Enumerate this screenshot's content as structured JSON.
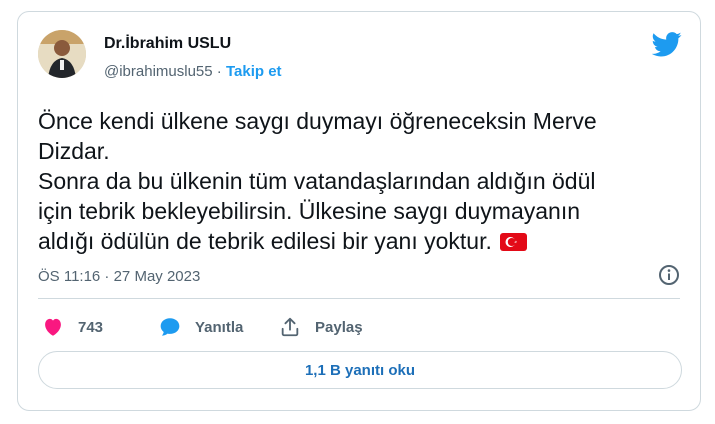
{
  "author": {
    "name": "Dr.İbrahim USLU",
    "handle": "@ibrahimuslu55",
    "separator": "·",
    "follow_label": "Takip et"
  },
  "tweet": {
    "line1": "Önce kendi ülkene saygı duymayı öğreneceksin Merve",
    "line2": "Dizdar.",
    "line3": "Sonra da bu ülkenin tüm vatandaşlarından aldığın ödül",
    "line4": "için tebrik bekleyebilirsin. Ülkesine saygı duymayanın",
    "line5": "aldığı ödülün de tebrik edilesi bir yanı yoktur.",
    "flag_emoji": "turkey-flag",
    "timestamp": "ÖS 11:16 · 27 May 2023"
  },
  "actions": {
    "like_count": "743",
    "reply_label": "Yanıtla",
    "share_label": "Paylaş"
  },
  "replies_button": "1,1 B yanıtı oku",
  "colors": {
    "accent": "#1d9bf0",
    "like": "#f91880",
    "reply_icon": "#1d9bf0",
    "muted": "#536471"
  },
  "icons": [
    "twitter-bird-icon",
    "info-icon",
    "heart-icon",
    "reply-icon",
    "share-icon"
  ]
}
